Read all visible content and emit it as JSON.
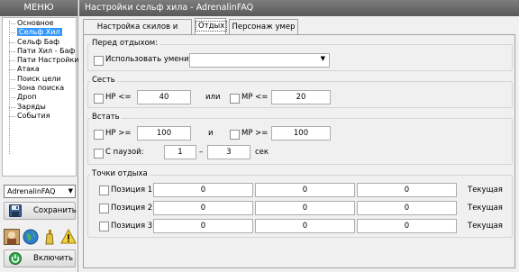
{
  "menu": {
    "title": "МЕНЮ",
    "items": [
      {
        "label": "Основное"
      },
      {
        "label": "Сельф Хил"
      },
      {
        "label": "Сельф Баф"
      },
      {
        "label": "Пати Хил - Баф"
      },
      {
        "label": "Пати Настройки"
      },
      {
        "label": "Атака"
      },
      {
        "label": "Поиск цели"
      },
      {
        "label": "Зона поиска"
      },
      {
        "label": "Дроп"
      },
      {
        "label": "Заряды"
      },
      {
        "label": "События"
      }
    ],
    "selected_index": 1,
    "profile": "AdrenalinFAQ",
    "save_label": "Сохранить",
    "enable_label": "Включить"
  },
  "window": {
    "title": "Настройки сельф хила  -  AdrenalinFAQ"
  },
  "tabs": [
    {
      "label": "Настройка скилов и итемов"
    },
    {
      "label": "Отдых"
    },
    {
      "label": "Персонаж умер"
    }
  ],
  "before_rest": {
    "title": "Перед отдыхом:",
    "use_skill_label": "Использовать умение:",
    "use_skill_value": ""
  },
  "sit": {
    "title": "Сесть",
    "hp_label": "HP  <=",
    "hp_value": "40",
    "or_label": "или",
    "mp_label": "MP  <=",
    "mp_value": "20"
  },
  "stand": {
    "title": "Встать",
    "hp_label": "HP  >=",
    "hp_value": "100",
    "and_label": "и",
    "mp_label": "MP  >=",
    "mp_value": "100",
    "pause_label": "С паузой:",
    "pause_from": "1",
    "dash": "–",
    "pause_to": "3",
    "unit": "сек"
  },
  "rest_points": {
    "title": "Точки отдыха",
    "rows": [
      {
        "label": "Позиция 1",
        "x": "0",
        "y": "0",
        "z": "0",
        "current": "Текущая"
      },
      {
        "label": "Позиция 2",
        "x": "0",
        "y": "0",
        "z": "0",
        "current": "Текущая"
      },
      {
        "label": "Позиция 3",
        "x": "0",
        "y": "0",
        "z": "0",
        "current": "Текущая"
      }
    ]
  }
}
